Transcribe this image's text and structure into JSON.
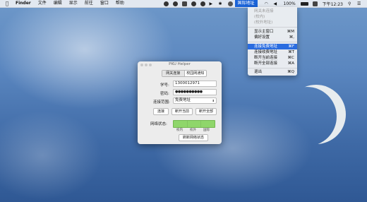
{
  "menubar": {
    "apple_icon": "apple-logo-icon",
    "app_name": "Finder",
    "menus": [
      "文件",
      "编辑",
      "显示",
      "前往",
      "窗口",
      "帮助"
    ],
    "tray_icons": [
      "wechat-icon",
      "qq-icon",
      "chat-icon",
      "cloud-icon",
      "settings-icon",
      "play-icon",
      "bluetooth-icon",
      "user-icon"
    ],
    "active_item": "国际地址",
    "battery": "100%",
    "battery_icon": "battery-icon",
    "input_method_icon": "input-method-icon",
    "clock": "下午12:23",
    "search_icon": "search-icon",
    "list_icon": "notification-list-icon"
  },
  "dropdown": {
    "items": [
      {
        "label": "网关未连接",
        "key": "",
        "disabled": true
      },
      {
        "label": "(校内)",
        "key": "",
        "disabled": true
      },
      {
        "label": "(校外地址)",
        "key": "",
        "disabled": true
      },
      {
        "label": "显示主窗口",
        "key": "⌘M",
        "disabled": false
      },
      {
        "label": "偏好设置",
        "key": "⌘,",
        "disabled": false
      },
      {
        "label": "连接免费地址",
        "key": "⌘F",
        "disabled": false,
        "highlighted": true
      },
      {
        "label": "连接收费地址",
        "key": "⌘T",
        "disabled": false
      },
      {
        "label": "断开当前连接",
        "key": "⌘C",
        "disabled": false
      },
      {
        "label": "断开全部连接",
        "key": "⌘A",
        "disabled": false
      },
      {
        "label": "退出",
        "key": "⌘Q",
        "disabled": false
      }
    ]
  },
  "window": {
    "title": "PKU Helper",
    "tabs": [
      "网关连接",
      "校园网通知"
    ],
    "student_id_label": "学号:",
    "student_id_value": "1300012971",
    "password_label": "密码:",
    "password_value": "●●●●●●●●●●",
    "range_label": "连接范围:",
    "range_value": "免费地址",
    "buttons": {
      "connect": "连接",
      "disconnect_current": "断开当前",
      "disconnect_all": "断开全部"
    },
    "status_label": "网络状态:",
    "status_sublabels": [
      "校内",
      "校外",
      "国际"
    ],
    "refresh_button": "刷新网络状态"
  }
}
